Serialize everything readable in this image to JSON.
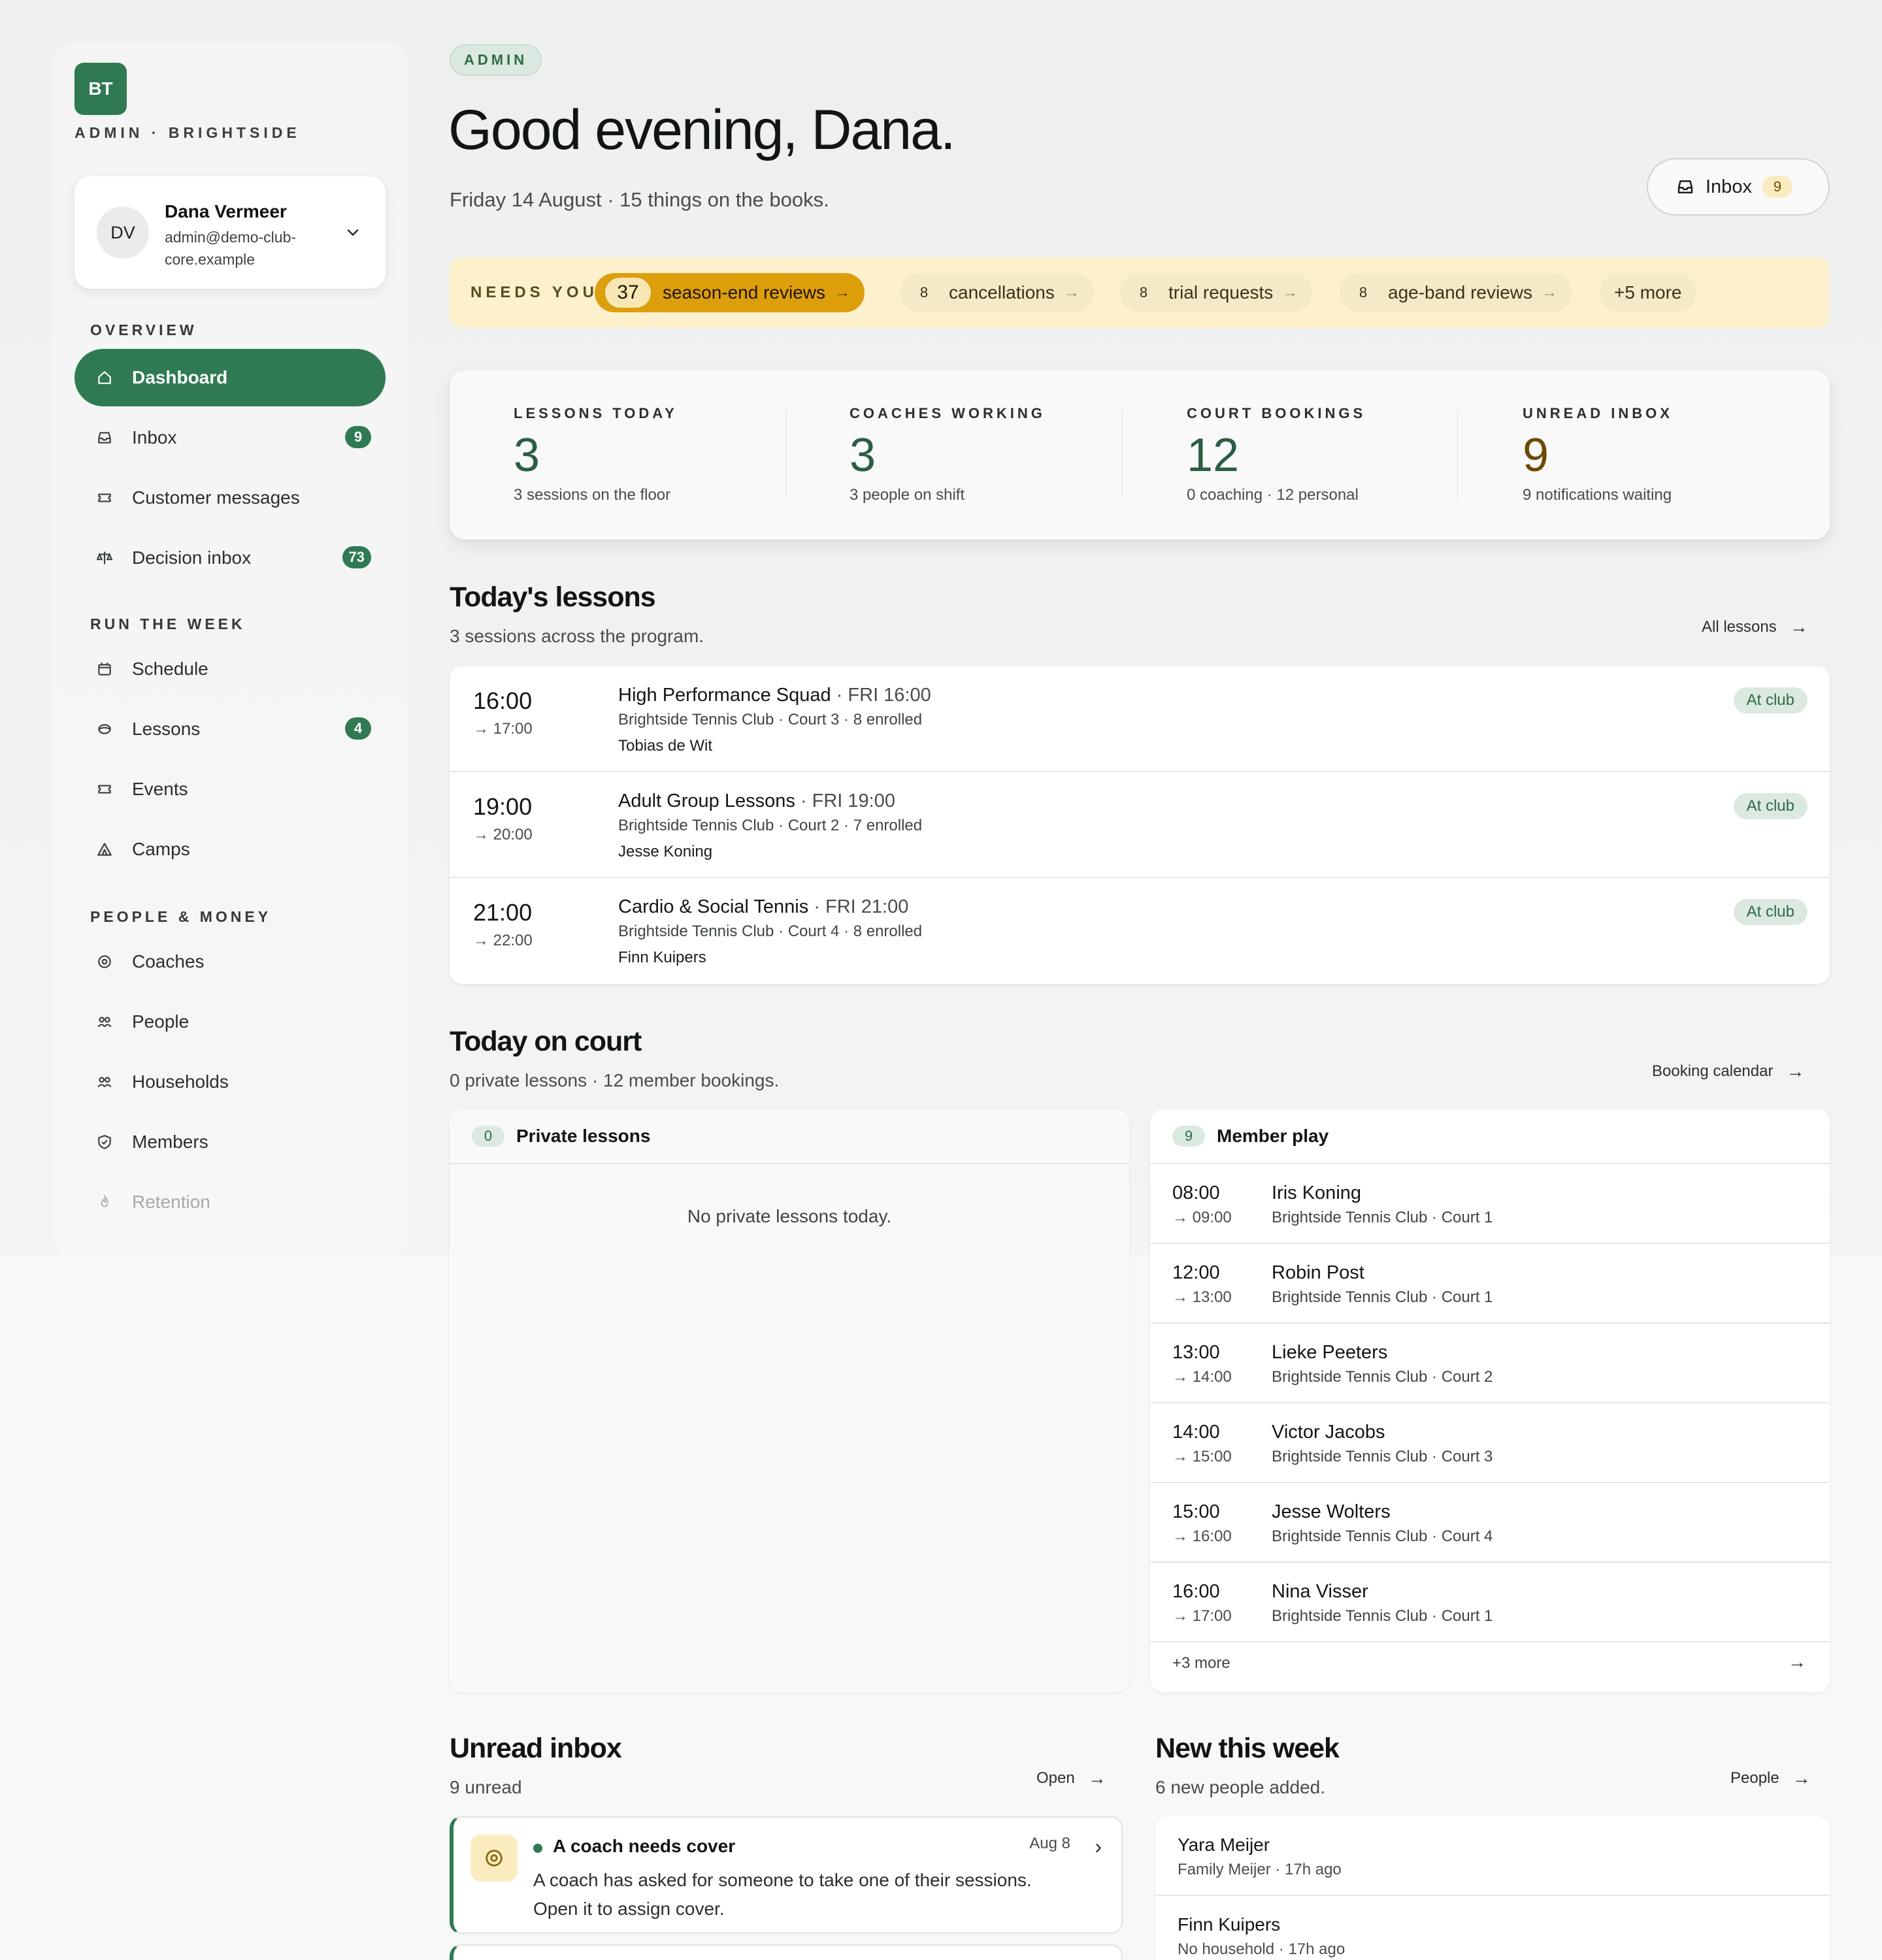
{
  "sidebar": {
    "logo": "BT",
    "org_line": "ADMIN · BRIGHTSIDE",
    "user": {
      "initials": "DV",
      "name": "Dana Vermeer",
      "email": "admin@demo-club-core.example"
    },
    "sections": {
      "overview": "OVERVIEW",
      "run_the_week": "RUN THE WEEK",
      "people_money": "PEOPLE & MONEY"
    },
    "items": [
      {
        "label": "Dashboard",
        "icon": "home-icon",
        "active": true
      },
      {
        "label": "Inbox",
        "icon": "inbox-icon",
        "badge": "9"
      },
      {
        "label": "Customer messages",
        "icon": "ticket-icon"
      },
      {
        "label": "Decision inbox",
        "icon": "scale-icon",
        "badge": "73"
      },
      {
        "label": "Schedule",
        "icon": "calendar-icon"
      },
      {
        "label": "Lessons",
        "icon": "ball-icon",
        "badge": "4"
      },
      {
        "label": "Events",
        "icon": "ticket-icon"
      },
      {
        "label": "Camps",
        "icon": "tent-icon"
      },
      {
        "label": "Coaches",
        "icon": "target-icon"
      },
      {
        "label": "People",
        "icon": "people-icon"
      },
      {
        "label": "Households",
        "icon": "people-icon"
      },
      {
        "label": "Members",
        "icon": "shield-icon"
      },
      {
        "label": "Retention",
        "icon": "flame-icon"
      }
    ]
  },
  "header": {
    "role_pill": "ADMIN",
    "greeting": "Good evening, Dana.",
    "subline": "Friday 14 August · 15 things on the books.",
    "inbox_button": {
      "label": "Inbox",
      "count": "9"
    }
  },
  "needs_you": {
    "label": "NEEDS YOU",
    "chips": [
      {
        "count": "37",
        "label": "season-end reviews",
        "primary": true
      },
      {
        "count": "8",
        "label": "cancellations"
      },
      {
        "count": "8",
        "label": "trial requests"
      },
      {
        "count": "8",
        "label": "age-band reviews"
      }
    ],
    "more": "+5 more"
  },
  "stats": [
    {
      "label": "LESSONS TODAY",
      "value": "3",
      "sub": "3 sessions on the floor"
    },
    {
      "label": "COACHES WORKING",
      "value": "3",
      "sub": "3 people on shift"
    },
    {
      "label": "COURT BOOKINGS",
      "value": "12",
      "sub": "0 coaching · 12 personal"
    },
    {
      "label": "UNREAD INBOX",
      "value": "9",
      "sub": "9 notifications waiting"
    }
  ],
  "lessons": {
    "title": "Today's lessons",
    "subtitle": "3 sessions across the program.",
    "link": "All lessons",
    "rows": [
      {
        "start": "16:00",
        "end": "→ 17:00",
        "title": "High Performance Squad",
        "time": " · FRI 16:00",
        "where": "Brightside Tennis Club · Court 3 · 8 enrolled",
        "coach": "Tobias de Wit",
        "badge": "At club"
      },
      {
        "start": "19:00",
        "end": "→ 20:00",
        "title": "Adult Group Lessons",
        "time": " · FRI 19:00",
        "where": "Brightside Tennis Club · Court 2 · 7 enrolled",
        "coach": "Jesse Koning",
        "badge": "At club"
      },
      {
        "start": "21:00",
        "end": "→ 22:00",
        "title": "Cardio & Social Tennis",
        "time": " · FRI 21:00",
        "where": "Brightside Tennis Club · Court 4 · 8 enrolled",
        "coach": "Finn Kuipers",
        "badge": "At club"
      }
    ]
  },
  "court": {
    "title": "Today on court",
    "subtitle": "0 private lessons · 12 member bookings.",
    "link": "Booking calendar",
    "private": {
      "count": "0",
      "title": "Private lessons",
      "empty": "No private lessons today."
    },
    "member": {
      "count": "9",
      "title": "Member play",
      "rows": [
        {
          "start": "08:00",
          "end": "→ 09:00",
          "name": "Iris Koning",
          "where": "Brightside Tennis Club · Court 1"
        },
        {
          "start": "12:00",
          "end": "→ 13:00",
          "name": "Robin Post",
          "where": "Brightside Tennis Club · Court 1"
        },
        {
          "start": "13:00",
          "end": "→ 14:00",
          "name": "Lieke Peeters",
          "where": "Brightside Tennis Club · Court 2"
        },
        {
          "start": "14:00",
          "end": "→ 15:00",
          "name": "Victor Jacobs",
          "where": "Brightside Tennis Club · Court 3"
        },
        {
          "start": "15:00",
          "end": "→ 16:00",
          "name": "Jesse Wolters",
          "where": "Brightside Tennis Club · Court 4"
        },
        {
          "start": "16:00",
          "end": "→ 17:00",
          "name": "Nina Visser",
          "where": "Brightside Tennis Club · Court 1"
        }
      ],
      "more": "+3 more"
    }
  },
  "unread": {
    "title": "Unread inbox",
    "subtitle": "9 unread",
    "link": "Open",
    "item": {
      "title": "A coach needs cover",
      "date": "Aug 8",
      "body": "A coach has asked for someone to take one of their sessions. Open it to assign cover."
    }
  },
  "new_week": {
    "title": "New this week",
    "subtitle": "6 new people added.",
    "link": "People",
    "rows": [
      {
        "name": "Yara Meijer",
        "sub": "Family Meijer · 17h ago"
      },
      {
        "name": "Finn Kuipers",
        "sub": "No household · 17h ago"
      }
    ]
  },
  "colors": {
    "brand_green": "#2f7a52",
    "amber": "#dd9e0c",
    "needs_bg": "#fcf1cc"
  }
}
